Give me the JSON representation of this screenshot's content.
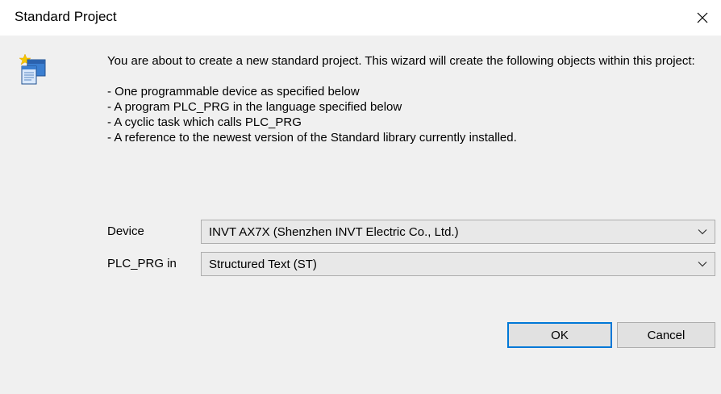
{
  "window": {
    "title": "Standard Project"
  },
  "message": {
    "intro": "You are about to create a new standard project. This wizard will create the following objects within this project:",
    "items": [
      "- One programmable device as specified below",
      "- A program PLC_PRG in the language specified below",
      "- A cyclic task which calls PLC_PRG",
      "- A reference to the newest version of the Standard library currently installed."
    ]
  },
  "form": {
    "device_label": "Device",
    "device_value": "INVT AX7X (Shenzhen INVT Electric Co., Ltd.)",
    "plc_prg_label": "PLC_PRG in",
    "plc_prg_value": "Structured Text (ST)"
  },
  "buttons": {
    "ok": "OK",
    "cancel": "Cancel"
  },
  "icons": {
    "close": "close-icon",
    "wizard": "project-wizard-icon",
    "dropdown": "chevron-down-icon"
  },
  "colors": {
    "default_button_border": "#0078d7",
    "dialog_bg": "#f0f0f0"
  }
}
